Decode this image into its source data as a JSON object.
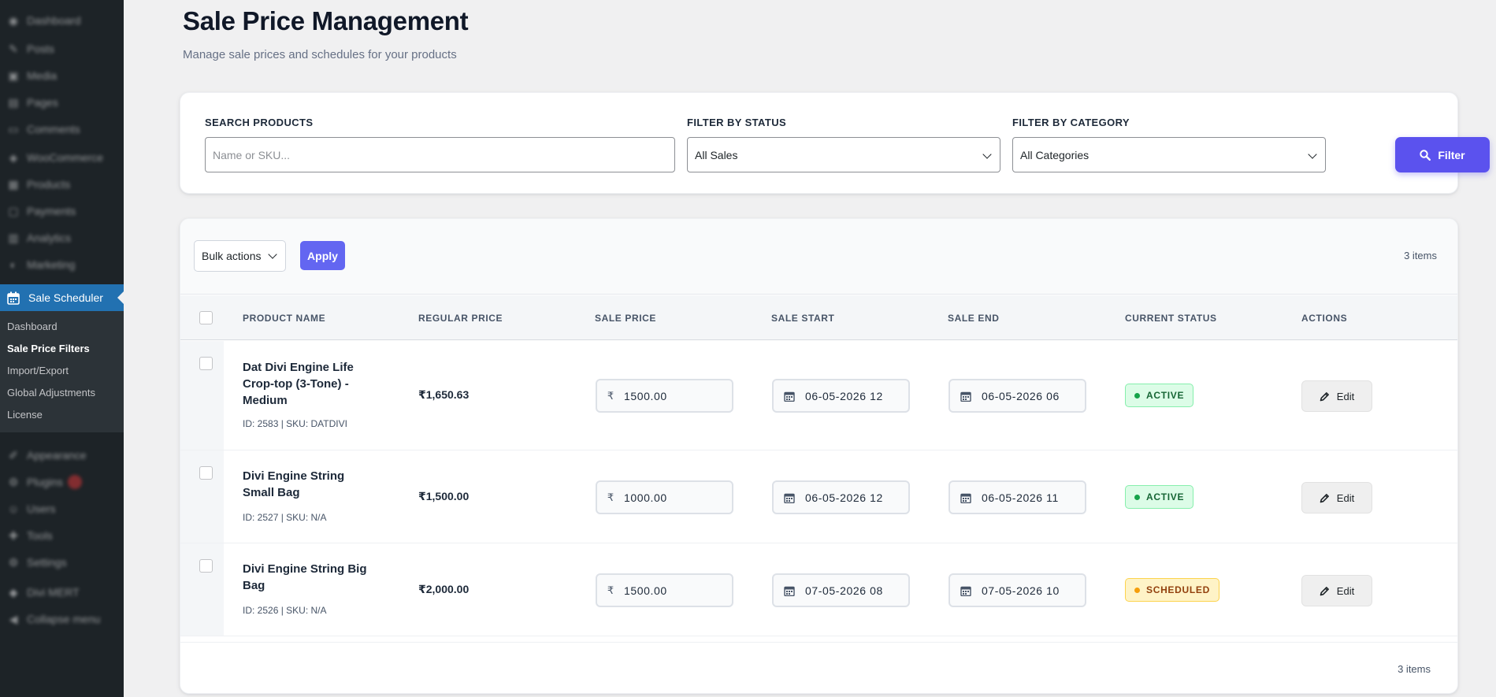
{
  "sidebar": {
    "top_items": [
      {
        "label": "Dashboard",
        "icon": "dashboard-icon"
      },
      {
        "label": "Posts",
        "icon": "posts-icon"
      },
      {
        "label": "Media",
        "icon": "media-icon"
      },
      {
        "label": "Pages",
        "icon": "pages-icon"
      },
      {
        "label": "Comments",
        "icon": "comments-icon"
      },
      {
        "label": "WooCommerce",
        "icon": "woocommerce-icon"
      },
      {
        "label": "Products",
        "icon": "products-icon"
      },
      {
        "label": "Payments",
        "icon": "payments-icon"
      },
      {
        "label": "Analytics",
        "icon": "analytics-icon"
      },
      {
        "label": "Marketing",
        "icon": "marketing-icon"
      }
    ],
    "active": {
      "label": "Sale Scheduler",
      "icon": "calendar-icon"
    },
    "submenu": [
      "Dashboard",
      "Sale Price Filters",
      "Import/Export",
      "Global Adjustments",
      "License"
    ],
    "submenu_current": "Sale Price Filters",
    "bottom_items": [
      {
        "label": "Appearance",
        "icon": "appearance-icon"
      },
      {
        "label": "Plugins",
        "icon": "plugins-icon"
      },
      {
        "label": "Users",
        "icon": "users-icon"
      },
      {
        "label": "Tools",
        "icon": "tools-icon"
      },
      {
        "label": "Settings",
        "icon": "settings-icon"
      },
      {
        "label": "Divi MERT",
        "icon": "divi-icon"
      },
      {
        "label": "Collapse menu",
        "icon": "collapse-icon"
      }
    ]
  },
  "header": {
    "title": "Sale Price Management",
    "subtitle": "Manage sale prices and schedules for your products"
  },
  "filters": {
    "search_label": "SEARCH PRODUCTS",
    "search_placeholder": "Name or SKU...",
    "search_value": "",
    "status_label": "FILTER BY STATUS",
    "status_value": "All Sales",
    "category_label": "FILTER BY CATEGORY",
    "category_value": "All Categories",
    "filter_button": "Filter"
  },
  "toolbar": {
    "bulk_value": "Bulk actions",
    "apply_label": "Apply",
    "count": "3 items"
  },
  "table": {
    "columns": [
      "PRODUCT NAME",
      "REGULAR PRICE",
      "SALE PRICE",
      "SALE START",
      "SALE END",
      "CURRENT STATUS",
      "ACTIONS"
    ],
    "currency_symbol": "₹",
    "edit_label": "Edit",
    "rows": [
      {
        "name": "Dat Divi Engine Life Crop-top (3-Tone) - Medium",
        "meta": "ID: 2583 | SKU: DATDIVI",
        "regular_price": "₹1,650.63",
        "sale_price": "1500.00",
        "sale_start": "06-05-2026 12",
        "sale_end": "06-05-2026 06",
        "status": "ACTIVE"
      },
      {
        "name": "Divi Engine String Small Bag",
        "meta": "ID: 2527 | SKU: N/A",
        "regular_price": "₹1,500.00",
        "sale_price": "1000.00",
        "sale_start": "06-05-2026 12",
        "sale_end": "06-05-2026 11",
        "status": "ACTIVE"
      },
      {
        "name": "Divi Engine String Big Bag",
        "meta": "ID: 2526 | SKU: N/A",
        "regular_price": "₹2,000.00",
        "sale_price": "1500.00",
        "sale_start": "07-05-2026 08",
        "sale_end": "07-05-2026 10",
        "status": "SCHEDULED"
      }
    ],
    "footer_count": "3 items"
  },
  "colors": {
    "sidebar_bg": "#1d2327",
    "sidebar_active": "#2271b1",
    "primary_button": "#5b52ee",
    "active_status": "#16a34a",
    "scheduled_status": "#f59e0b"
  }
}
